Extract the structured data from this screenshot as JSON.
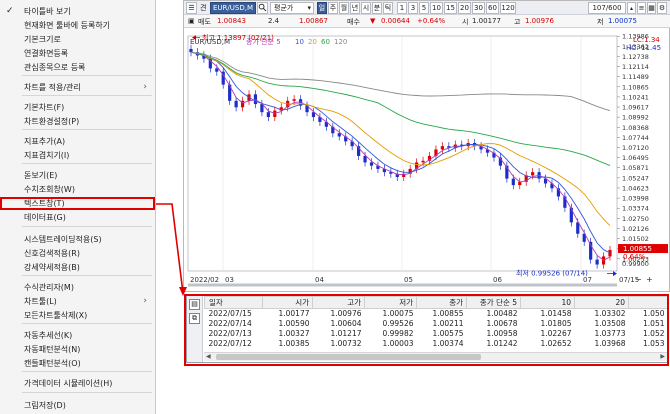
{
  "context_menu": {
    "items": [
      {
        "label": "타이틀바 보기",
        "checked": true,
        "submenu": false
      },
      {
        "label": "현재화면 툴바에 등록하기",
        "checked": false,
        "submenu": false
      },
      {
        "label": "기본크기로",
        "checked": false,
        "submenu": false
      },
      {
        "label": "연결화면등록",
        "checked": false,
        "submenu": false
      },
      {
        "label": "관심종목으로 등록",
        "checked": false,
        "submenu": false
      },
      {
        "label": "차트를 적용/관리",
        "checked": false,
        "submenu": true
      },
      {
        "label": "기본차트(F)",
        "checked": false,
        "submenu": false
      },
      {
        "label": "차트환경설정(P)",
        "checked": false,
        "submenu": false
      },
      {
        "label": "지표추가(A)",
        "checked": false,
        "submenu": false
      },
      {
        "label": "지표겹치기(I)",
        "checked": false,
        "submenu": false
      },
      {
        "label": "돋보기(E)",
        "checked": false,
        "submenu": false
      },
      {
        "label": "수치조회창(W)",
        "checked": false,
        "submenu": false
      },
      {
        "label": "텍스트창(T)",
        "checked": false,
        "submenu": false,
        "highlighted": true
      },
      {
        "label": "데이터표(G)",
        "checked": false,
        "submenu": false
      },
      {
        "label": "시스템트레이딩적용(S)",
        "checked": false,
        "submenu": false
      },
      {
        "label": "신호검색적용(R)",
        "checked": false,
        "submenu": false
      },
      {
        "label": "강세약세적용(B)",
        "checked": false,
        "submenu": false
      },
      {
        "label": "수식관리자(M)",
        "checked": false,
        "submenu": false
      },
      {
        "label": "차트툴(L)",
        "checked": false,
        "submenu": true
      },
      {
        "label": "모든차트툴삭제(X)",
        "checked": false,
        "submenu": false
      },
      {
        "label": "자동추세선(K)",
        "checked": false,
        "submenu": false
      },
      {
        "label": "자동패턴분석(N)",
        "checked": false,
        "submenu": false
      },
      {
        "label": "캔들패턴분석(O)",
        "checked": false,
        "submenu": false
      },
      {
        "label": "가격데이터 시뮬레이션(H)",
        "checked": false,
        "submenu": false
      },
      {
        "label": "그림저장(D)",
        "checked": false,
        "submenu": false
      }
    ]
  },
  "toolbar": {
    "menu_btn": "☰",
    "symbol_label": "견",
    "symbol_value": "EUR/USD,M",
    "search_icon": "search-icon",
    "price_type": "평균가",
    "period_buttons": [
      "일",
      "주",
      "월",
      "년",
      "시",
      "분",
      "틱"
    ],
    "active_period": "일",
    "interval_buttons": [
      "1",
      "3",
      "5",
      "10",
      "15",
      "20",
      "30",
      "60",
      "120"
    ],
    "count": "107/600",
    "row2": {
      "sell_label": "매도",
      "sell_value": "1.00843",
      "spread": "2.4",
      "buy_value": "1.00867",
      "buy_label": "매수",
      "change_icon": "down-triangle-icon",
      "change": "0.00644",
      "change_pct": "+0.64%",
      "open_label": "시",
      "open_value": "1.00177",
      "high_label": "고",
      "high_value": "1.00976",
      "close_label": "저",
      "close_value": "1.00075"
    }
  },
  "chart": {
    "legend": {
      "symbol": "EUR/USD,M",
      "ma_label": "종가 단순 5",
      "ma_periods": [
        "10",
        "20",
        "60",
        "120"
      ]
    },
    "annotations": {
      "high": "최고 1.13897 (02/21)",
      "low": "최저 0.99526 (07/14)"
    },
    "right_labels": {
      "lc": "LC:1.34",
      "hc": "HC:-11.45",
      "price_tag": "1.00855",
      "pct_tag": "0.64%",
      "last_tick": "0.99900"
    },
    "xlabels": [
      "2022/02",
      "03",
      "04",
      "05",
      "06",
      "07",
      "07/15"
    ],
    "yticks": [
      "1.13986",
      "1.13362",
      "1.12738",
      "1.12114",
      "1.11489",
      "1.10865",
      "1.10241",
      "1.09617",
      "1.08992",
      "1.08368",
      "1.07744",
      "1.07120",
      "1.06495",
      "1.05871",
      "1.05247",
      "1.04623",
      "1.03998",
      "1.03374",
      "1.02750",
      "1.02126",
      "1.01502",
      "1.00877",
      "1.00253"
    ],
    "zoom_icons": [
      "zoom-out-icon",
      "zoom-in-icon"
    ]
  },
  "chart_data": {
    "type": "candlestick",
    "title": "EUR/USD,M",
    "ylim": [
      0.995,
      1.14
    ],
    "x_range": [
      "2022/02",
      "07/15"
    ],
    "high": {
      "date": "02/21",
      "value": 1.13897
    },
    "low": {
      "date": "07/14",
      "value": 0.99526
    },
    "last_close": 1.00855,
    "series": [
      {
        "name": "종가 단순 5",
        "color": "#b03bb3"
      },
      {
        "name": "10",
        "color": "#3355dd"
      },
      {
        "name": "20",
        "color": "#e89a00"
      },
      {
        "name": "60",
        "color": "#2aa84a"
      },
      {
        "name": "120",
        "color": "#888888"
      }
    ],
    "approx_close_path": [
      1.13,
      1.128,
      1.126,
      1.12,
      1.118,
      1.11,
      1.1,
      1.096,
      1.1,
      1.104,
      1.098,
      1.093,
      1.09,
      1.094,
      1.096,
      1.1,
      1.101,
      1.097,
      1.093,
      1.09,
      1.087,
      1.084,
      1.08,
      1.078,
      1.075,
      1.072,
      1.066,
      1.062,
      1.06,
      1.058,
      1.056,
      1.055,
      1.053,
      1.055,
      1.058,
      1.062,
      1.063,
      1.066,
      1.07,
      1.072,
      1.071,
      1.073,
      1.072,
      1.074,
      1.072,
      1.07,
      1.068,
      1.065,
      1.06,
      1.052,
      1.048,
      1.05,
      1.054,
      1.056,
      1.052,
      1.049,
      1.046,
      1.041,
      1.034,
      1.025,
      1.018,
      1.013,
      1.002,
      0.999,
      1.004,
      1.008
    ],
    "colors": {
      "up": "#e00000",
      "down": "#1a2ecc"
    }
  },
  "data_table": {
    "columns": [
      "일자",
      "시가",
      "고가",
      "저가",
      "종가",
      "종가 단순 5",
      "10",
      "20",
      ""
    ],
    "rows": [
      [
        "2022/07/15",
        "1.00177",
        "1.00976",
        "1.00075",
        "1.00855",
        "1.00482",
        "1.01458",
        "1.03302",
        "1.050"
      ],
      [
        "2022/07/14",
        "1.00590",
        "1.00604",
        "0.99526",
        "1.00211",
        "1.00678",
        "1.01805",
        "1.03508",
        "1.051"
      ],
      [
        "2022/07/13",
        "1.00327",
        "1.01217",
        "0.99982",
        "1.00575",
        "1.00958",
        "1.02267",
        "1.03773",
        "1.052"
      ],
      [
        "2022/07/12",
        "1.00385",
        "1.00732",
        "1.00003",
        "1.00374",
        "1.01242",
        "1.02652",
        "1.03968",
        "1.053"
      ]
    ],
    "tool_icons": [
      "table-tool-icon",
      "copy-tool-icon"
    ]
  },
  "colors": {
    "highlight": "#e00000",
    "up_candle": "#e00000",
    "down_candle": "#1a2ecc",
    "toolbar_blue": "#3a5e9a"
  }
}
